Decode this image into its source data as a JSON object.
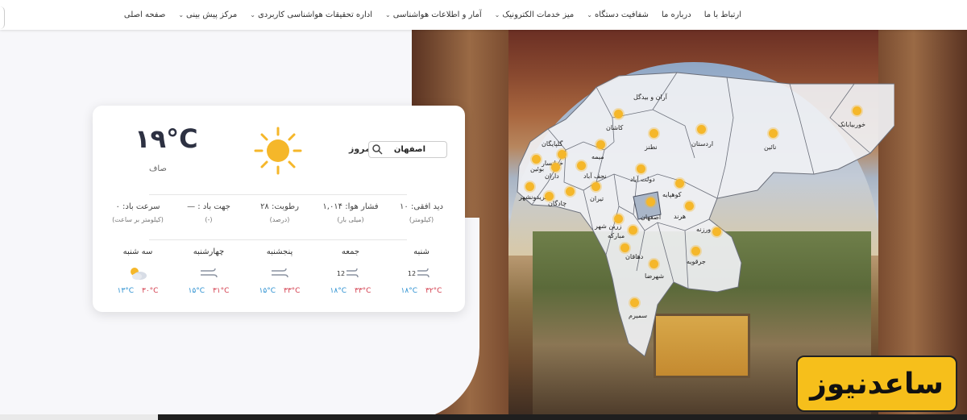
{
  "nav": {
    "items": [
      {
        "label": "صفحه اصلی",
        "dropdown": false
      },
      {
        "label": "مرکز پیش بینی",
        "dropdown": true
      },
      {
        "label": "اداره تحقیقات هواشناسی کاربردی",
        "dropdown": true
      },
      {
        "label": "آمار و اطلاعات هواشناسی",
        "dropdown": true
      },
      {
        "label": "میز خدمات الکترونیک",
        "dropdown": true
      },
      {
        "label": "شفافیت دستگاه",
        "dropdown": true
      },
      {
        "label": "درباره ما",
        "dropdown": false
      },
      {
        "label": "ارتباط با ما",
        "dropdown": false
      }
    ]
  },
  "weather": {
    "today_label": "امروز",
    "city_value": "اصفهان",
    "temperature": "۱۹°C",
    "condition": "صاف",
    "stats": [
      {
        "label": "سرعت باد: ۰",
        "sub": "(کیلومتر بر ساعت)"
      },
      {
        "label": "جهت باد : —",
        "sub": "(-)"
      },
      {
        "label": "رطوبت: ۲۸",
        "sub": "(درصد)"
      },
      {
        "label": "فشار هوا: ۱,۰۱۴",
        "sub": "(میلی بار)"
      },
      {
        "label": "دید افقی: ۱۰",
        "sub": "(کیلومتر)"
      }
    ],
    "forecast": [
      {
        "day": "سه شنبه",
        "icon": "cloud-sun-icon",
        "max": "۳۰°C",
        "min": "۱۳°C"
      },
      {
        "day": "چهارشنبه",
        "icon": "wind-icon",
        "max": "۳۱°C",
        "min": "۱۵°C"
      },
      {
        "day": "پنجشنبه",
        "icon": "wind-icon",
        "max": "۳۳°C",
        "min": "۱۵°C"
      },
      {
        "day": "جمعه",
        "icon": "wind-12-icon",
        "wind_value": "12",
        "max": "۳۳°C",
        "min": "۱۸°C"
      },
      {
        "day": "شنبه",
        "icon": "wind-12-icon",
        "wind_value": "12",
        "max": "۳۲°C",
        "min": "۱۸°C"
      }
    ]
  },
  "map": {
    "cities": [
      {
        "name": "آران و بیدگل"
      },
      {
        "name": "کاشان"
      },
      {
        "name": "خوربیابانک"
      },
      {
        "name": "گلپایگان"
      },
      {
        "name": "خوانسار"
      },
      {
        "name": "میمه"
      },
      {
        "name": "نطنز"
      },
      {
        "name": "اردستان"
      },
      {
        "name": "نائین"
      },
      {
        "name": "بوئین"
      },
      {
        "name": "داران"
      },
      {
        "name": "نجف آباد"
      },
      {
        "name": "دولت آباد"
      },
      {
        "name": "فریدونشهر"
      },
      {
        "name": "چادگان"
      },
      {
        "name": "تیران"
      },
      {
        "name": "کوهپایه"
      },
      {
        "name": "اصفهان"
      },
      {
        "name": "هرند"
      },
      {
        "name": "زرین شهر"
      },
      {
        "name": "مبارکه"
      },
      {
        "name": "ورزنه"
      },
      {
        "name": "جرقویه"
      },
      {
        "name": "دهاقان"
      },
      {
        "name": "شهرضا"
      },
      {
        "name": "سمیرم"
      }
    ]
  },
  "logo": {
    "text": "ساعدنیوز"
  },
  "colors": {
    "max_temp": "#d23a4a",
    "min_temp": "#2a8fd0",
    "sun": "#f5b72a",
    "logo_bg": "#f6bf1b"
  }
}
